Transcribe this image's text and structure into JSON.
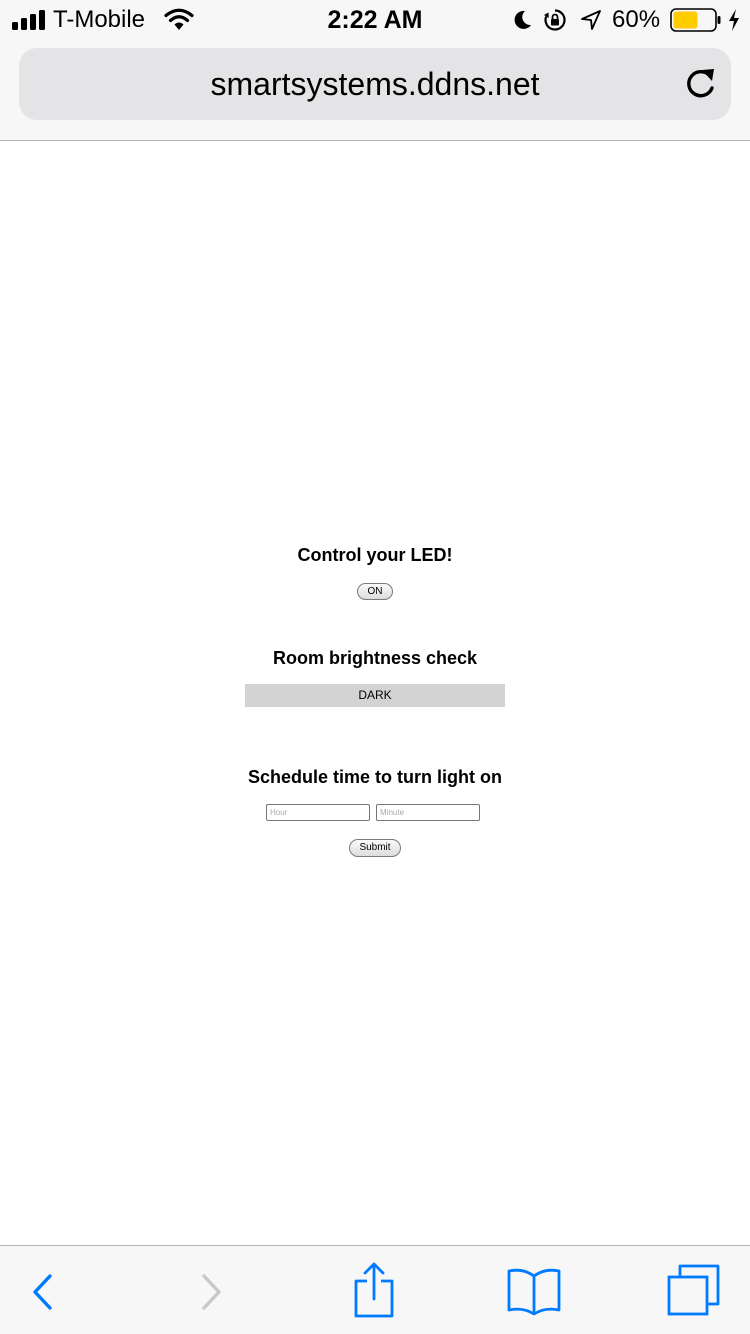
{
  "status_bar": {
    "carrier": "T-Mobile",
    "time": "2:22 AM",
    "battery_percent": "60%",
    "battery_level": 0.6,
    "battery_color": "#ffcc00",
    "icons": [
      "signal-icon",
      "wifi-icon",
      "moon-icon",
      "rotation-lock-icon",
      "location-arrow-icon",
      "battery-icon",
      "charging-bolt-icon"
    ]
  },
  "browser": {
    "url": "smartsystems.ddns.net",
    "reload_icon": "reload-icon",
    "toolbar_icons": [
      "back-icon",
      "forward-icon",
      "share-icon",
      "bookmarks-icon",
      "tabs-icon"
    ],
    "accent_color": "#007aff",
    "disabled_color": "#c7c7cc"
  },
  "page": {
    "led_heading": "Control your LED!",
    "led_button": "ON",
    "brightness_heading": "Room brightness check",
    "brightness_value": "DARK",
    "schedule_heading": "Schedule time to turn light on",
    "hour_placeholder": "Hour",
    "minute_placeholder": "Minute",
    "submit_label": "Submit"
  }
}
